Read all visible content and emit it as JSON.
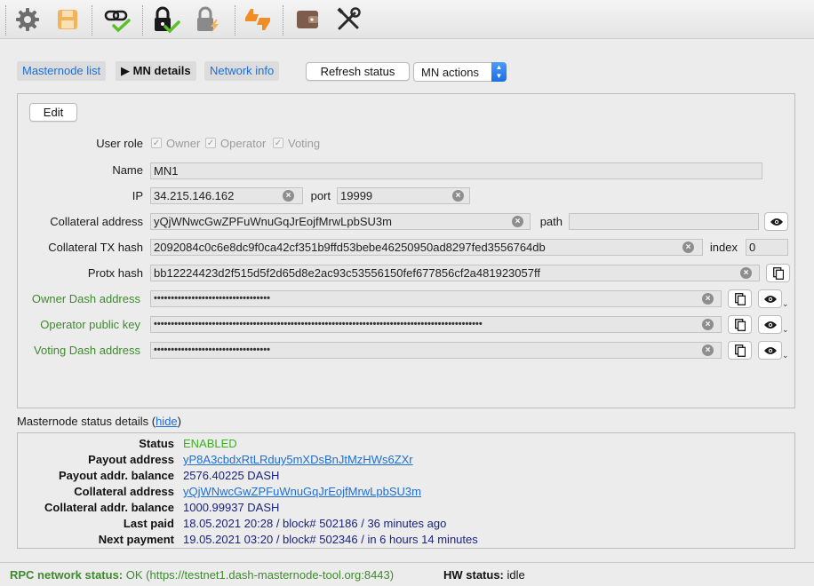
{
  "toolbar": {
    "icons": [
      "gear-icon",
      "save-icon",
      "link-check-icon",
      "lock-check-icon",
      "lock-lightning-icon",
      "thumbs-icon",
      "wallet-icon",
      "tools-icon"
    ]
  },
  "tabs": {
    "masternode_list": "Masternode list",
    "mn_details": "▶ MN details",
    "network_info": "Network info"
  },
  "actions": {
    "refresh_status": "Refresh status",
    "mn_actions": "MN actions",
    "edit": "Edit"
  },
  "form": {
    "user_role_label": "User role",
    "roles": [
      "Owner",
      "Operator",
      "Voting"
    ],
    "name_label": "Name",
    "name": "MN1",
    "ip_label": "IP",
    "ip": "34.215.146.162",
    "port_label": "port",
    "port": "19999",
    "collateral_address_label": "Collateral address",
    "collateral_address": "yQjWNwcGwZPFuWnuGqJrEojfMrwLpbSU3m",
    "path_label": "path",
    "path": "",
    "collateral_tx_label": "Collateral TX hash",
    "collateral_tx": "2092084c0c6e8dc9f0ca42cf351b9ffd53bebe46250950ad8297fed3556764db",
    "index_label": "index",
    "index": "0",
    "protx_label": "Protx hash",
    "protx": "bb12224423d2f515d5f2d65d8e2ac93c53556150fef677856cf2a481923057ff",
    "owner_label": "Owner Dash address",
    "owner_mask": "••••••••••••••••••••••••••••••••••",
    "operator_label": "Operator public key",
    "operator_mask": "••••••••••••••••••••••••••••••••••••••••••••••••••••••••••••••••••••••••••••••••••••••••••••••••",
    "voting_label": "Voting Dash address",
    "voting_mask": "••••••••••••••••••••••••••••••••••"
  },
  "status_details": {
    "title": "Masternode status details (",
    "hide_link": "hide",
    "title_end": ")",
    "rows": [
      {
        "key": "Status",
        "value": "ENABLED"
      },
      {
        "key": "Payout address",
        "value": "yP8A3cbdxRtLRduy5mXDsBnJtMzHWs6ZXr"
      },
      {
        "key": "Payout addr. balance",
        "value": "2576.40225 DASH"
      },
      {
        "key": "Collateral address",
        "value": "yQjWNwcGwZPFuWnuGqJrEojfMrwLpbSU3m"
      },
      {
        "key": "Collateral addr. balance",
        "value": "1000.99937 DASH"
      },
      {
        "key": "Last paid",
        "value": "18.05.2021 20:28 / block# 502186 / 36 minutes ago"
      },
      {
        "key": "Next payment",
        "value": "19.05.2021 03:20 / block# 502346 / in 6 hours 14 minutes"
      }
    ]
  },
  "statusbar": {
    "rpc_label": "RPC network status:",
    "rpc_value": "OK (https://testnet1.dash-masternode-tool.org:8443)",
    "hw_label": "HW status:",
    "hw_value": "idle"
  },
  "colors": {
    "accent": "#1e6fd6",
    "ok_green": "#3cb021",
    "label_green": "#3f8a2e",
    "value_navy": "#1a237e"
  }
}
